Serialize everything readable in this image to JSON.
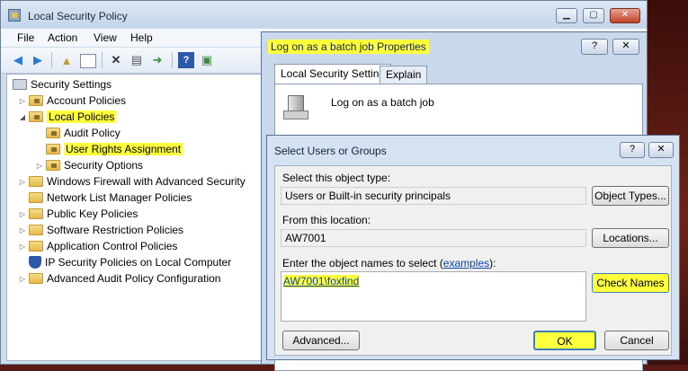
{
  "main_window": {
    "title": "Local Security Policy",
    "controls": {
      "minimize": "▁",
      "maximize": "▢",
      "close": "✕"
    },
    "menu": [
      "File",
      "Action",
      "View",
      "Help"
    ],
    "toolbar_icons": [
      "back-arrow-icon",
      "forward-arrow-icon",
      "up-folder-icon",
      "show-hide-tree-icon",
      "delete-icon",
      "properties-icon",
      "export-icon",
      "help-icon",
      "console-icon"
    ]
  },
  "tree": {
    "root": "Security Settings",
    "items": [
      {
        "label": "Account Policies"
      },
      {
        "label": "Local Policies"
      },
      {
        "label": "Audit Policy"
      },
      {
        "label": "User Rights Assignment"
      },
      {
        "label": "Security Options"
      },
      {
        "label": "Windows Firewall with Advanced Security"
      },
      {
        "label": "Network List Manager Policies"
      },
      {
        "label": "Public Key Policies"
      },
      {
        "label": "Software Restriction Policies"
      },
      {
        "label": "Application Control Policies"
      },
      {
        "label": "IP Security Policies on Local Computer"
      },
      {
        "label": "Advanced Audit Policy Configuration"
      }
    ],
    "highlight_color": "#ffff3c"
  },
  "properties_dialog": {
    "title": "Log on as a batch job Properties",
    "help": "?",
    "close": "✕",
    "tabs": [
      "Local Security Setting",
      "Explain"
    ],
    "policy_name": "Log on as a batch job"
  },
  "select_dialog": {
    "title": "Select Users or Groups",
    "help": "?",
    "close": "✕",
    "object_type_label": "Select this object type:",
    "object_type_value": "Users or Built-in security principals",
    "object_types_button": "Object Types...",
    "location_label": "From this location:",
    "location_value": "AW7001",
    "locations_button": "Locations...",
    "names_label_prefix": "Enter the object names to select (",
    "names_label_link": "examples",
    "names_label_suffix": "):",
    "names_value": "AW7001\\foxfind",
    "check_names_button": "Check Names",
    "advanced_button": "Advanced...",
    "ok_button": "OK",
    "cancel_button": "Cancel"
  }
}
